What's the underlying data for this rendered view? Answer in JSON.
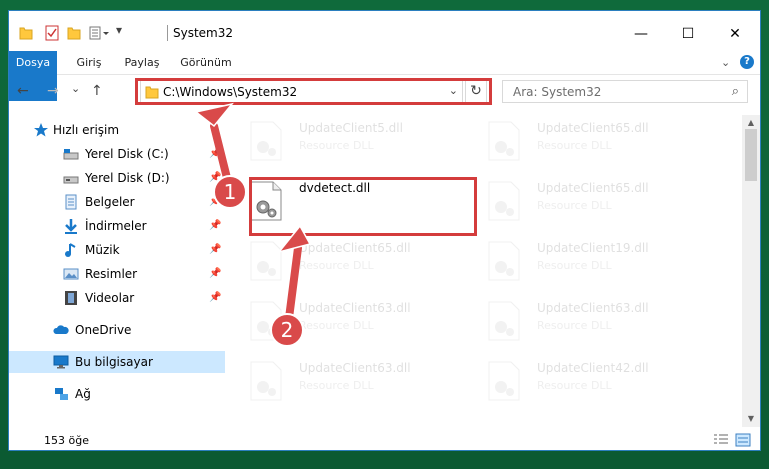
{
  "window": {
    "title": "System32",
    "minimize_glyph": "—",
    "maximize_glyph": "☐",
    "close_glyph": "✕"
  },
  "ribbon": {
    "tabs": [
      {
        "label": "Dosya"
      },
      {
        "label": "Giriş"
      },
      {
        "label": "Paylaş"
      },
      {
        "label": "Görünüm"
      }
    ],
    "expand_glyph": "⌄",
    "help_glyph": "?"
  },
  "navigation": {
    "back_glyph": "←",
    "forward_glyph": "→",
    "recent_glyph": "⌄",
    "up_glyph": "↑",
    "address": "C:\\Windows\\System32",
    "address_dropdown_glyph": "⌄",
    "refresh_glyph": "↻",
    "search_placeholder": "Ara: System32",
    "search_glyph": "⌕"
  },
  "sidebar": {
    "pin_glyph": "📌",
    "items": [
      {
        "label": "Hızlı erişim",
        "icon": "star-icon"
      },
      {
        "label": "Yerel Disk (C:)",
        "icon": "drive-icon"
      },
      {
        "label": "Yerel Disk (D:)",
        "icon": "drive-icon"
      },
      {
        "label": "Belgeler",
        "icon": "documents-icon"
      },
      {
        "label": "İndirmeler",
        "icon": "download-icon"
      },
      {
        "label": "Müzik",
        "icon": "music-icon"
      },
      {
        "label": "Resimler",
        "icon": "pictures-icon"
      },
      {
        "label": "Videolar",
        "icon": "videos-icon"
      },
      {
        "label": "OneDrive",
        "icon": "cloud-icon"
      },
      {
        "label": "Bu bilgisayar",
        "icon": "computer-icon"
      },
      {
        "label": "Ağ",
        "icon": "network-icon"
      }
    ]
  },
  "files": [
    {
      "name": "UpdateClient5.dll",
      "type": "Resource DLL"
    },
    {
      "name": "UpdateClient65.dll",
      "type": "Resource DLL"
    },
    {
      "name": "dvdetect.dll",
      "type": ""
    },
    {
      "name": "UpdateClient65.dll",
      "type": "Resource DLL"
    },
    {
      "name": "UpdateClient65.dll",
      "type": "Resource DLL"
    },
    {
      "name": "UpdateClient19.dll",
      "type": "Resource DLL"
    },
    {
      "name": "UpdateClient63.dll",
      "type": "Resource DLL"
    },
    {
      "name": "UpdateClient63.dll",
      "type": "Resource DLL"
    },
    {
      "name": "UpdateClient63.dll",
      "type": "Resource DLL"
    },
    {
      "name": "UpdateClient42.dll",
      "type": "Resource DLL"
    }
  ],
  "status": {
    "item_count": "153 öğe"
  },
  "annotations": {
    "step1": "1",
    "step2": "2",
    "highlight_color": "#d43c3c",
    "badge_color": "#d94a4a"
  },
  "colors": {
    "accent": "#1979ca",
    "selected": "#cce8ff",
    "folder": "#ffc83d"
  }
}
